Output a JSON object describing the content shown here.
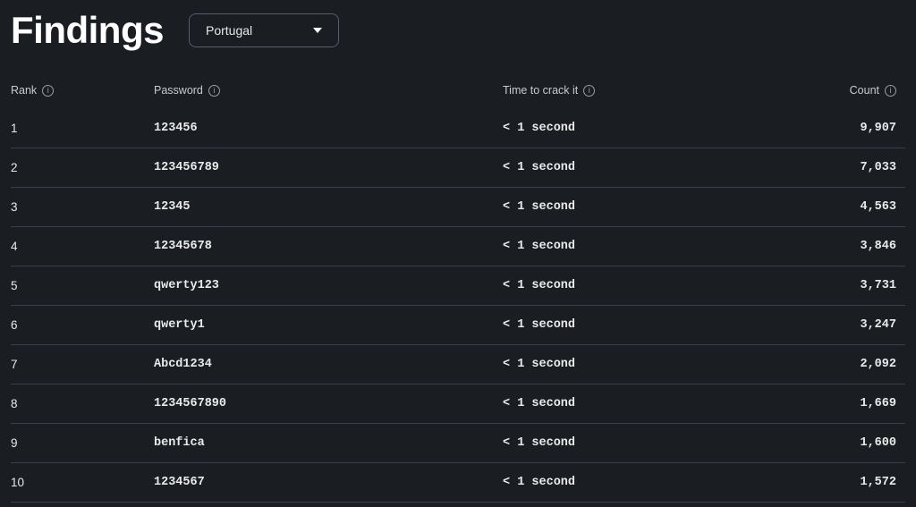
{
  "header": {
    "title": "Findings",
    "dropdown_selected": "Portugal"
  },
  "table": {
    "columns": {
      "rank": "Rank",
      "password": "Password",
      "time": "Time to crack it",
      "count": "Count"
    },
    "rows": [
      {
        "rank": "1",
        "password": "123456",
        "time": "< 1 second",
        "count": "9,907"
      },
      {
        "rank": "2",
        "password": "123456789",
        "time": "< 1 second",
        "count": "7,033"
      },
      {
        "rank": "3",
        "password": "12345",
        "time": "< 1 second",
        "count": "4,563"
      },
      {
        "rank": "4",
        "password": "12345678",
        "time": "< 1 second",
        "count": "3,846"
      },
      {
        "rank": "5",
        "password": "qwerty123",
        "time": "< 1 second",
        "count": "3,731"
      },
      {
        "rank": "6",
        "password": "qwerty1",
        "time": "< 1 second",
        "count": "3,247"
      },
      {
        "rank": "7",
        "password": "Abcd1234",
        "time": "< 1 second",
        "count": "2,092"
      },
      {
        "rank": "8",
        "password": "1234567890",
        "time": "< 1 second",
        "count": "1,669"
      },
      {
        "rank": "9",
        "password": "benfica",
        "time": "< 1 second",
        "count": "1,600"
      },
      {
        "rank": "10",
        "password": "1234567",
        "time": "< 1 second",
        "count": "1,572"
      }
    ]
  }
}
